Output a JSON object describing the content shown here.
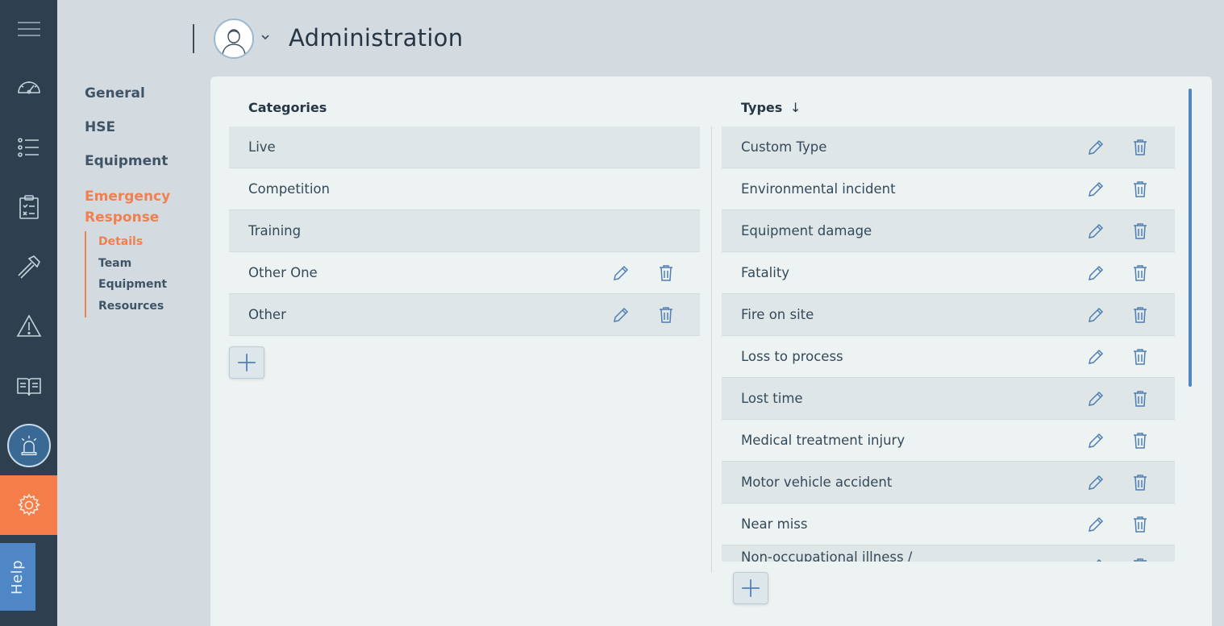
{
  "app": {
    "title": "Administration",
    "help_label": "Help"
  },
  "rail": {
    "items": [
      {
        "icon": "menu-icon"
      },
      {
        "icon": "dashboard-gauge-icon"
      },
      {
        "icon": "list-icon"
      },
      {
        "icon": "clipboard-checklist-icon"
      },
      {
        "icon": "hammer-icon"
      },
      {
        "icon": "warning-triangle-icon"
      },
      {
        "icon": "open-book-icon"
      },
      {
        "icon": "alarm-siren-icon"
      },
      {
        "icon": "settings-gear-icon"
      }
    ],
    "active": "settings-gear-icon"
  },
  "subnav": {
    "items": [
      "General",
      "HSE",
      "Equipment",
      "Emergency Response"
    ],
    "active": "Emergency Response",
    "children": [
      "Details",
      "Team",
      "Equipment",
      "Resources"
    ],
    "active_child": "Details"
  },
  "categories": {
    "header": "Categories",
    "rows": [
      "Live",
      "Competition",
      "Training",
      "Other One",
      "Other"
    ]
  },
  "types": {
    "header": "Types",
    "sort_indicator": "↓",
    "rows": [
      "Custom Type",
      "Environmental incident",
      "Equipment damage",
      "Fatality",
      "Fire on site",
      "Loss to process",
      "Lost time",
      "Medical treatment injury",
      "Motor vehicle accident",
      "Near miss",
      "Non-occupational illness /"
    ]
  },
  "colors": {
    "rail_bg": "#2e4050",
    "accent_orange": "#f47d4a",
    "accent_blue": "#4f86c6",
    "row_shaded": "#dfe6e7"
  }
}
